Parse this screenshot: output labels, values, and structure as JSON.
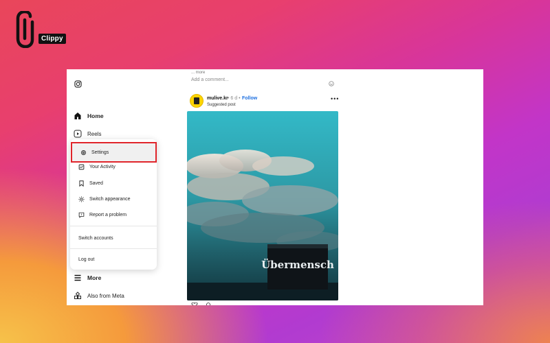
{
  "brand": {
    "logo_text": "Clippy"
  },
  "sidebar": {
    "home_label": "Home",
    "reels_label": "Reels",
    "more_label": "More",
    "meta_label": "Also from Meta"
  },
  "menu": {
    "settings_label": "Settings",
    "activity_label": "Your Activity",
    "saved_label": "Saved",
    "appearance_label": "Switch appearance",
    "report_label": "Report a problem",
    "switch_accounts_label": "Switch accounts",
    "logout_label": "Log out",
    "highlight_color": "#e0242a"
  },
  "feed": {
    "more_text": "... more",
    "comment_placeholder": "Add a comment...",
    "post": {
      "username": "mulive.kr",
      "time": "• 6 d •",
      "follow_label": "Follow",
      "suggested_label": "Suggested post",
      "image_text": "Übermensch"
    }
  }
}
